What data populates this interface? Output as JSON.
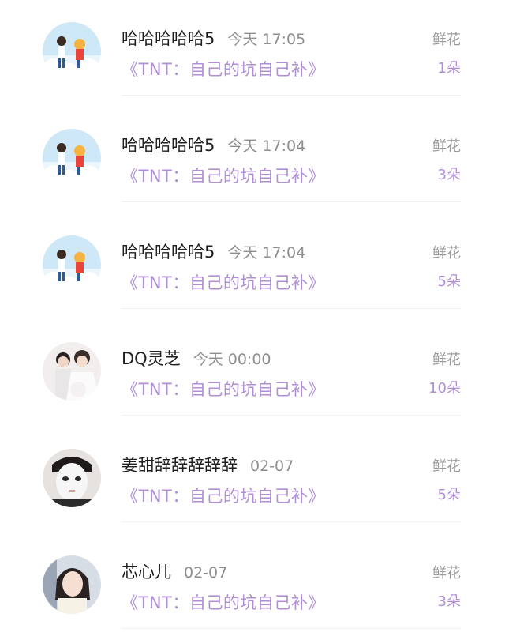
{
  "items": [
    {
      "user": "哈哈哈哈哈5",
      "time": "今天 17:05",
      "book": "《TNT：自己的坑自己补》",
      "gift_label": "鲜花",
      "gift_count": "1朵",
      "avatar": "anime-avatar"
    },
    {
      "user": "哈哈哈哈哈5",
      "time": "今天 17:04",
      "book": "《TNT：自己的坑自己补》",
      "gift_label": "鲜花",
      "gift_count": "3朵",
      "avatar": "anime-avatar"
    },
    {
      "user": "哈哈哈哈哈5",
      "time": "今天 17:04",
      "book": "《TNT：自己的坑自己补》",
      "gift_label": "鲜花",
      "gift_count": "5朵",
      "avatar": "anime-avatar"
    },
    {
      "user": "DQ灵芝",
      "time": "今天 00:00",
      "book": "《TNT：自己的坑自己补》",
      "gift_label": "鲜花",
      "gift_count": "10朵",
      "avatar": "couple-photo-avatar"
    },
    {
      "user": "姜甜辞辞辞辞辞",
      "time": "02-07",
      "book": "《TNT：自己的坑自己补》",
      "gift_label": "鲜花",
      "gift_count": "5朵",
      "avatar": "face-mask-photo-avatar"
    },
    {
      "user": "芯心儿",
      "time": "02-07",
      "book": "《TNT：自己的坑自己补》",
      "gift_label": "鲜花",
      "gift_count": "3朵",
      "avatar": "girl-photo-avatar"
    }
  ]
}
